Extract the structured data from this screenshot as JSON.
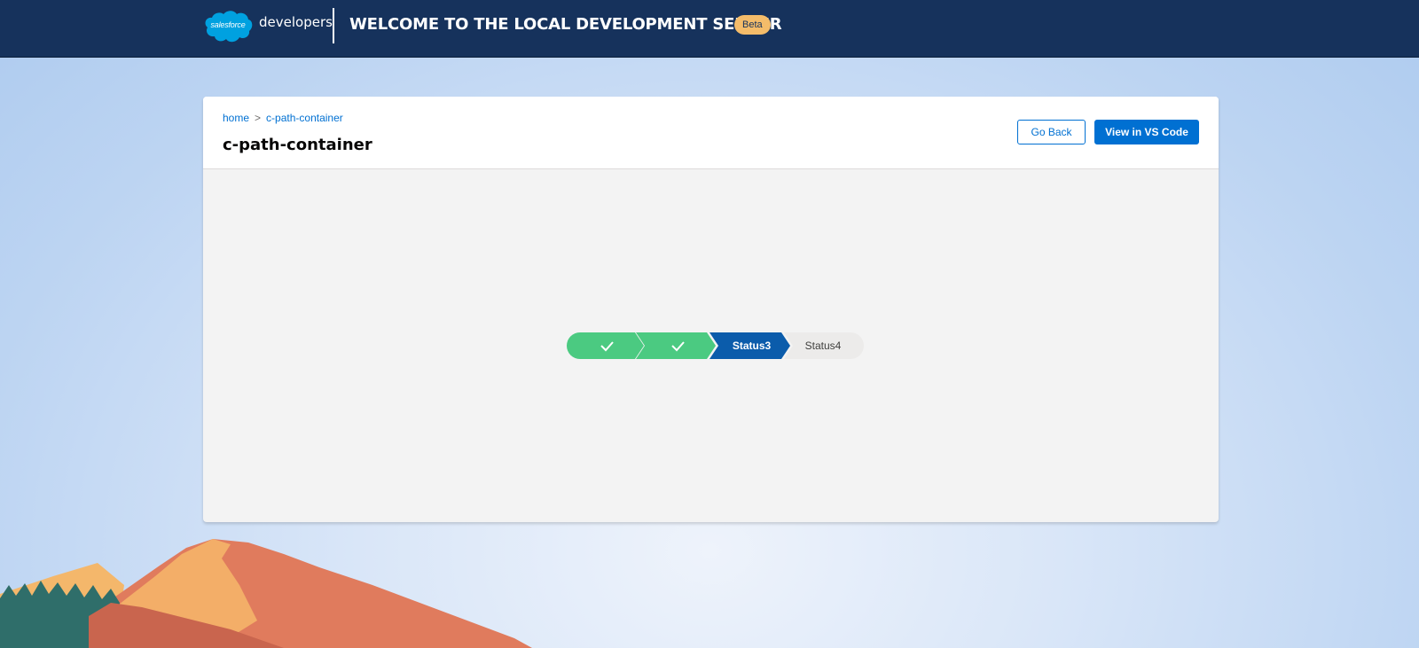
{
  "header": {
    "logo_text": "salesforce",
    "brand_word": "developers",
    "title": "Welcome to the Local Development Server",
    "badge": "Beta"
  },
  "breadcrumb": {
    "home": "home",
    "separator": ">",
    "current": "c-path-container"
  },
  "page": {
    "title": "c-path-container"
  },
  "actions": {
    "go_back": "Go Back",
    "view_in_vscode": "View in VS Code"
  },
  "path": {
    "steps": [
      {
        "state": "complete",
        "icon": "check-icon"
      },
      {
        "state": "complete",
        "icon": "check-icon"
      },
      {
        "state": "current",
        "label": "Status3"
      },
      {
        "state": "incomplete",
        "label": "Status4"
      }
    ]
  },
  "colors": {
    "header_bg": "#16325c",
    "brand_blue": "#0070d2",
    "path_complete": "#4bca81",
    "path_current": "#0b5cab",
    "path_incomplete": "#ecebea",
    "badge": "#f4bc6a"
  }
}
